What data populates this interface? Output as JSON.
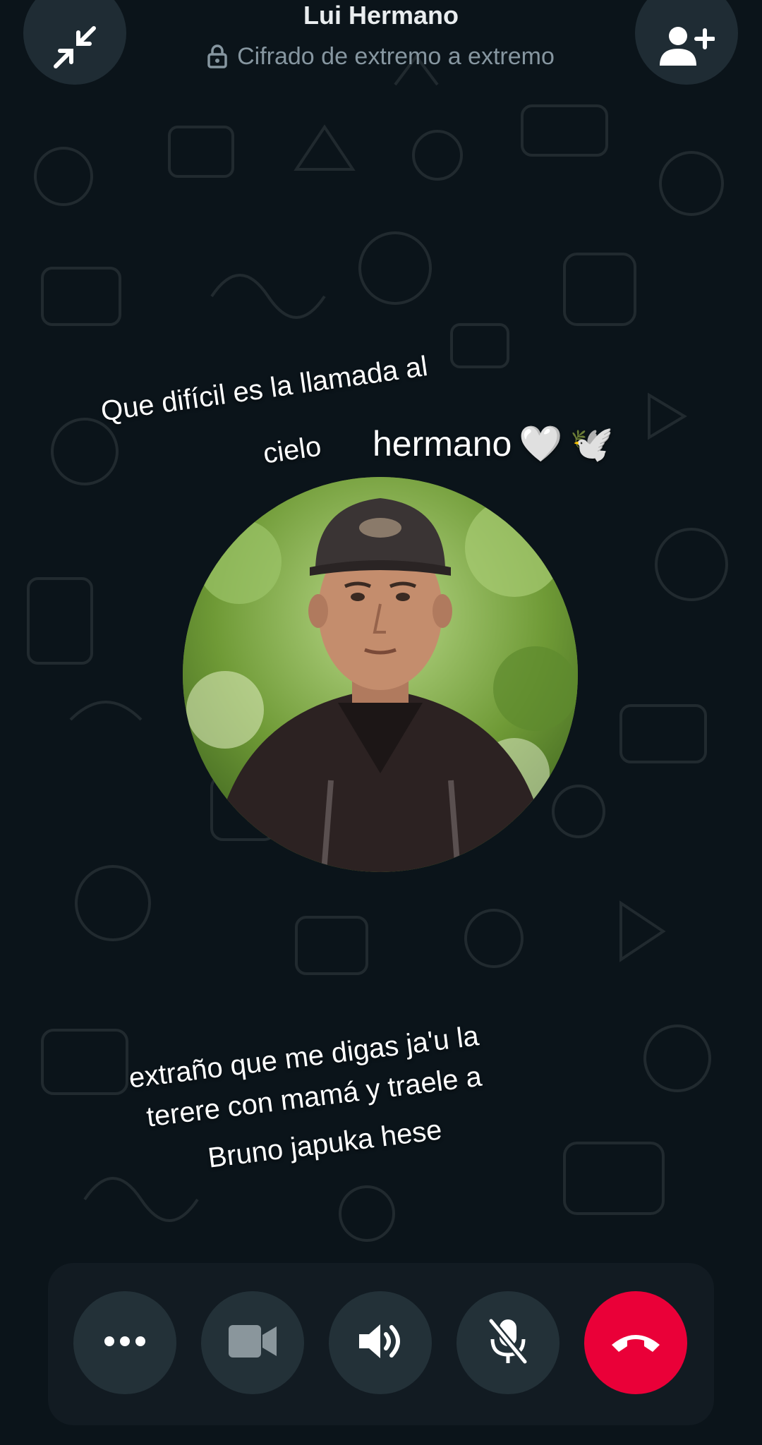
{
  "header": {
    "contact_name": "Lui Hermano",
    "encryption_text": "Cifrado de extremo a extremo",
    "minimize_icon": "minimize-arrows-icon",
    "add_participant_icon": "add-person-icon"
  },
  "overlay": {
    "top_caption_line1": "Que difícil es la llamada al",
    "top_caption_line2": "cielo",
    "top_caption_word": "hermano",
    "top_caption_emoji_heart": "🤍",
    "top_caption_emoji_dove": "🕊️",
    "bottom_caption_line1": "extraño que me digas ja'u la",
    "bottom_caption_line2": "terere con mamá y traele a",
    "bottom_caption_line3": "Bruno japuka hese"
  },
  "call_controls": {
    "more_icon": "more-options-icon",
    "video_icon": "video-camera-icon",
    "speaker_icon": "speaker-icon",
    "mute_icon": "microphone-muted-icon",
    "end_call_icon": "end-call-icon"
  },
  "colors": {
    "background": "#0b141a",
    "control_button": "#233138",
    "end_call": "#ea0038",
    "secondary_text": "#8696a0"
  }
}
